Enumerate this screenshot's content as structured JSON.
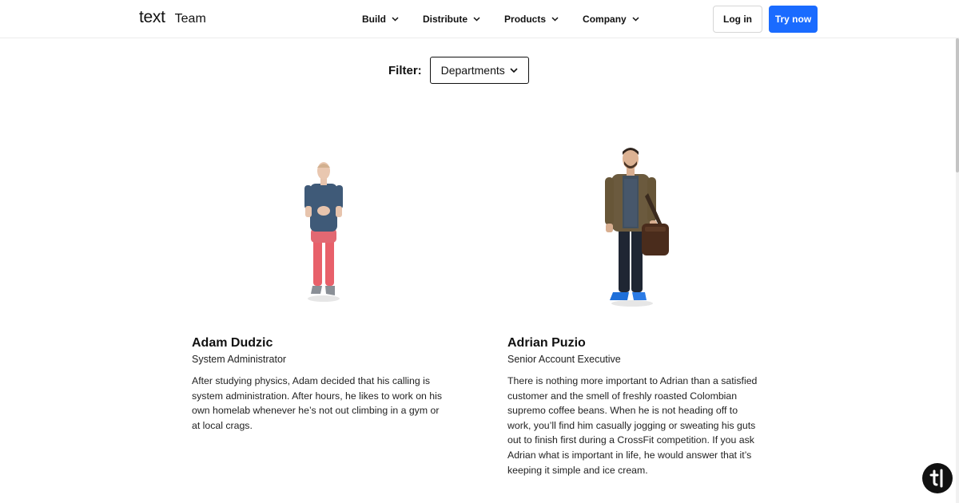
{
  "header": {
    "brand_logo": "text",
    "brand_section": "Team",
    "nav": [
      {
        "label": "Build"
      },
      {
        "label": "Distribute"
      },
      {
        "label": "Products"
      },
      {
        "label": "Company"
      }
    ],
    "login_label": "Log in",
    "try_label": "Try now"
  },
  "filter": {
    "label": "Filter:",
    "selected": "Departments"
  },
  "members": [
    {
      "name": "Adam Dudzic",
      "role": "System Administrator",
      "bio": "After studying physics, Adam decided that his calling is system administration. After hours, he likes to work on his own homelab whenever he’s not out climbing in a gym or at local crags."
    },
    {
      "name": "Adrian Puzio",
      "role": "Senior Account Executive",
      "bio": "There is nothing more important to Adrian than a satisfied customer and the smell of freshly roasted Colombian supremo coffee beans. When he is not heading off to work, you’ll find him casually jogging or sweating his guts out to finish first during a CrossFit competition. If you ask Adrian what is important in life, he would answer that it’s keeping it simple and ice cream."
    }
  ],
  "colors": {
    "accent": "#1a6bff",
    "text": "#111111"
  }
}
